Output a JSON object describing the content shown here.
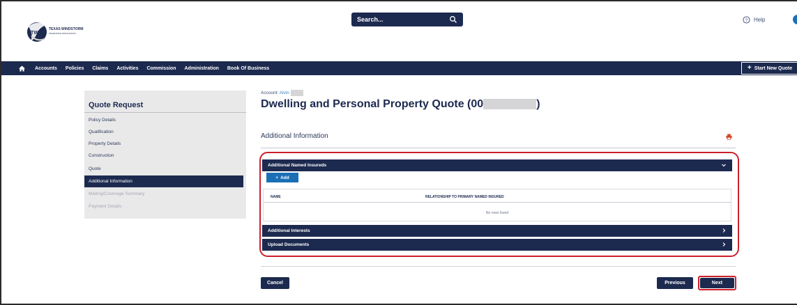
{
  "header": {
    "logo_text": "TEXAS WINDSTORM",
    "logo_subtext": "INSURANCE ASSOCIATION",
    "logo_mark": "TWIA",
    "search_placeholder": "Search...",
    "help_label": "Help"
  },
  "nav": {
    "items": [
      "Accounts",
      "Policies",
      "Claims",
      "Activities",
      "Commission",
      "Administration",
      "Book Of Business"
    ],
    "start_quote_label": "Start New Quote"
  },
  "sidebar": {
    "title": "Quote Request",
    "items": [
      {
        "label": "Policy Details",
        "state": "normal"
      },
      {
        "label": "Qualification",
        "state": "normal"
      },
      {
        "label": "Property Details",
        "state": "normal"
      },
      {
        "label": "Construction",
        "state": "normal"
      },
      {
        "label": "Quote",
        "state": "normal"
      },
      {
        "label": "Additional Information",
        "state": "active"
      },
      {
        "label": "Mailing/Coverage Summary",
        "state": "disabled"
      },
      {
        "label": "Payment Details",
        "state": "disabled"
      }
    ]
  },
  "main": {
    "account_label": "Account:",
    "account_name": "Alvin",
    "title_prefix": "Dwelling and Personal Property Quote (00",
    "title_suffix": ")",
    "section_title": "Additional Information",
    "panels": {
      "named_insureds": "Additional Named Insureds",
      "interests": "Additional Interests",
      "documents": "Upload Documents"
    },
    "add_label": "Add",
    "table": {
      "columns": [
        "NAME",
        "RELATIONSHIP TO PRIMARY NAMED INSURED"
      ],
      "empty_text": "No rows found"
    },
    "buttons": {
      "cancel": "Cancel",
      "previous": "Previous",
      "next": "Next"
    }
  },
  "colors": {
    "navy": "#1d2a4f",
    "accent_blue": "#1a6fb5",
    "highlight_red": "#cc1f2b",
    "sidebar_bg": "#e9e9ea"
  }
}
